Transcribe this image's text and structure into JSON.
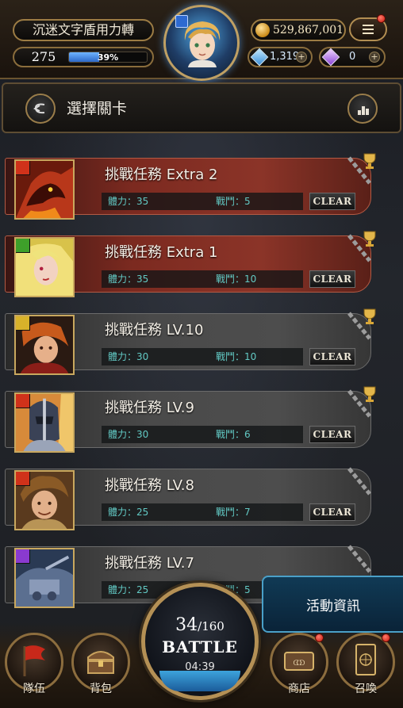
{
  "header": {
    "player_name": "沉迷文字盾用力轉",
    "level": "275",
    "exp_text": "39%",
    "exp_percent": 39,
    "gold": "529,867,001",
    "crystals": "1,319",
    "soul_gems": "0",
    "icons": {
      "menu": "hamburger-menu-icon",
      "gold": "gold-coin-icon",
      "crystal": "blue-crystal-icon",
      "soul_gem": "purple-gem-icon",
      "plus": "plus-icon"
    }
  },
  "stage_bar": {
    "title": "選擇關卡",
    "back_icon": "back-arrow-icon",
    "rank_icon": "podium-icon"
  },
  "missions": [
    {
      "title": "挑戰任務 Extra 2",
      "stamina": "體力：35",
      "battles": "戰鬥：5",
      "clear": "CLEAR",
      "style": "red",
      "element": "fire",
      "trophy": true
    },
    {
      "title": "挑戰任務 Extra 1",
      "stamina": "體力：35",
      "battles": "戰鬥：10",
      "clear": "CLEAR",
      "style": "red",
      "element": "wood",
      "trophy": true
    },
    {
      "title": "挑戰任務 LV.10",
      "stamina": "體力：30",
      "battles": "戰鬥：10",
      "clear": "CLEAR",
      "style": "grey",
      "element": "light",
      "trophy": true
    },
    {
      "title": "挑戰任務 LV.9",
      "stamina": "體力：30",
      "battles": "戰鬥：6",
      "clear": "CLEAR",
      "style": "grey",
      "element": "fire",
      "trophy": true
    },
    {
      "title": "挑戰任務 LV.8",
      "stamina": "體力：25",
      "battles": "戰鬥：7",
      "clear": "CLEAR",
      "style": "grey",
      "element": "fire",
      "trophy": false
    },
    {
      "title": "挑戰任務 LV.7",
      "stamina": "體力：25",
      "battles": "戰鬥：5",
      "clear": "",
      "style": "grey",
      "element": "dark",
      "trophy": false
    }
  ],
  "bottom_nav": {
    "team": "隊伍",
    "bag": "背包",
    "battle_count": "34",
    "battle_max": "/160",
    "battle_label": "BATTLE",
    "battle_timer": "04:39",
    "event": "活動資訊",
    "shop": "商店",
    "summon": "召喚"
  },
  "colors": {
    "accent_gold": "#b49055",
    "stat_teal": "#62c9c4",
    "notify_red": "#c8170b",
    "exp_blue": "#2d69c8",
    "event_blue": "#103a55"
  }
}
